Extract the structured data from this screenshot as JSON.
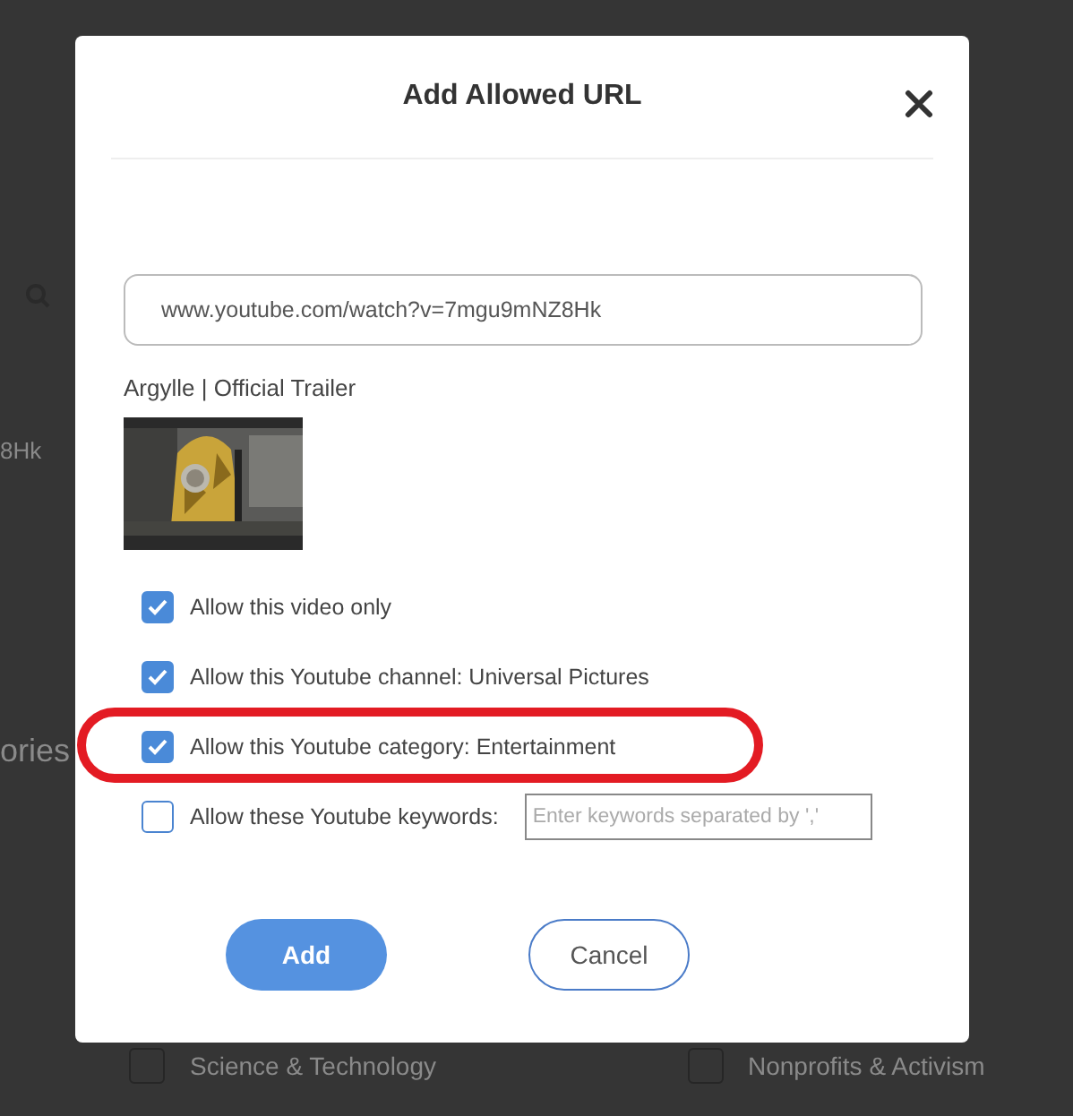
{
  "background": {
    "fragments": [
      "8Hk",
      "ories"
    ],
    "categories": [
      {
        "label": "Science & Technology",
        "checked": false
      },
      {
        "label": "Nonprofits & Activism",
        "checked": false
      }
    ]
  },
  "dialog": {
    "title": "Add Allowed URL",
    "url_field": {
      "value": "www.youtube.com/watch?v=7mgu9mNZ8Hk"
    },
    "video_title": "Argylle | Official Trailer",
    "options": [
      {
        "kind": "checkbox",
        "label": "Allow this video only",
        "checked": true,
        "highlighted": false
      },
      {
        "kind": "checkbox",
        "label": "Allow this Youtube channel: Universal Pictures",
        "checked": true,
        "highlighted": false
      },
      {
        "kind": "checkbox",
        "label": "Allow this Youtube category: Entertainment",
        "checked": true,
        "highlighted": true
      },
      {
        "kind": "keywords",
        "label": "Allow these Youtube keywords:",
        "checked": false,
        "highlighted": false,
        "placeholder": "Enter keywords separated by ','"
      }
    ],
    "buttons": [
      {
        "kind": "primary",
        "label": "Add"
      },
      {
        "kind": "secondary",
        "label": "Cancel"
      }
    ]
  }
}
